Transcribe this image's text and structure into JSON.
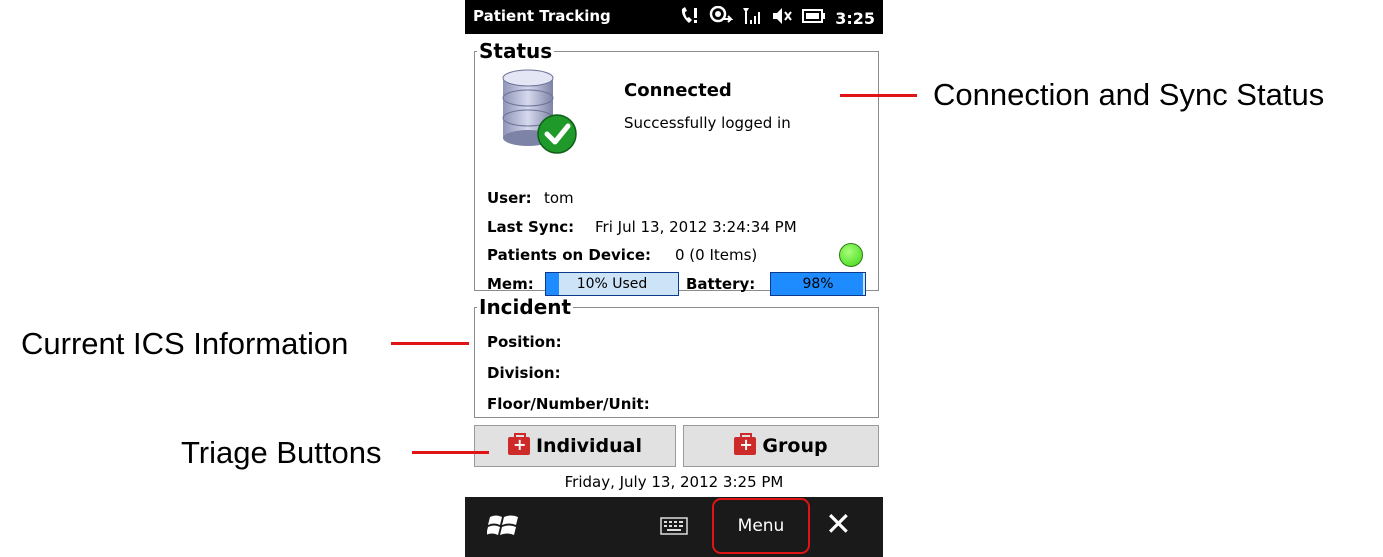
{
  "titlebar": {
    "app_title": "Patient Tracking",
    "time": "3:25"
  },
  "status": {
    "legend": "Status",
    "connection": "Connected",
    "message": "Successfully logged in",
    "user_label": "User:",
    "user_value": "tom",
    "last_sync_label": "Last Sync:",
    "last_sync_value": "Fri Jul 13, 2012 3:24:34 PM",
    "patients_label": "Patients on Device:",
    "patients_value": "0 (0 Items)",
    "mem_label": "Mem:",
    "mem_text": "10% Used",
    "mem_fraction": 0.1,
    "battery_label": "Battery:",
    "battery_text": "98%",
    "battery_fraction": 0.98,
    "indicator_color": "#3cd614"
  },
  "incident": {
    "legend": "Incident",
    "position_label": "Position:",
    "division_label": "Division:",
    "floor_label": "Floor/Number/Unit:"
  },
  "triage": {
    "individual_label": "Individual",
    "group_label": "Group"
  },
  "datetime": "Friday, July 13, 2012 3:25 PM",
  "bottombar": {
    "menu_label": "Menu",
    "close_glyph": "✕",
    "windows_icon": "windows-flag-icon",
    "keyboard_icon": "keyboard-icon"
  },
  "annotations": {
    "connection": "Connection and Sync Status",
    "ics": "Current ICS Information",
    "triage": "Triage Buttons"
  },
  "colors": {
    "accent_red": "#e01414",
    "progress_blue": "#1e8bff"
  }
}
